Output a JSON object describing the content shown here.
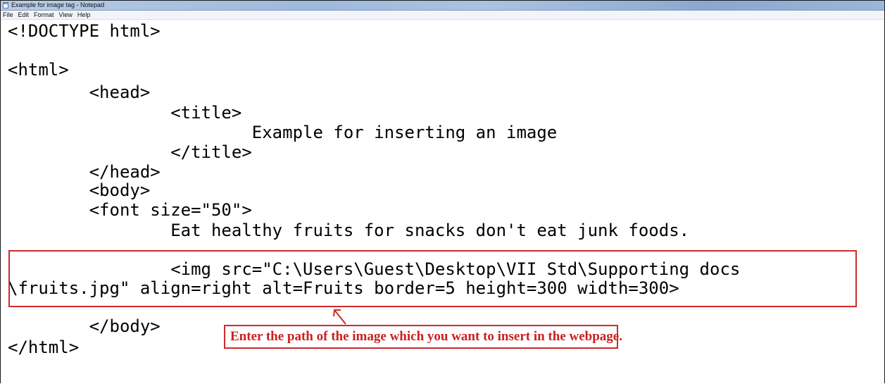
{
  "window": {
    "title": "Example for image tag - Notepad"
  },
  "menu": {
    "items": [
      "File",
      "Edit",
      "Format",
      "View",
      "Help"
    ]
  },
  "editor": {
    "lines": [
      "<!DOCTYPE html>",
      "<html>",
      "        <head>",
      "                <title>",
      "                        Example for inserting an image",
      "                </title>",
      "        </head>",
      "        <body>",
      "        <font size=\"50\">",
      "                Eat healthy fruits for snacks don't eat junk foods.",
      "                <img src=\"C:\\Users\\Guest\\Desktop\\VII Std\\Supporting docs",
      "\\fruits.jpg\" align=right alt=Fruits border=5 height=300 width=300>",
      "        </body>",
      "</html>"
    ]
  },
  "annotation": {
    "callout_text": "Enter the path of the image which you want to insert in the webpage.",
    "color": "#cc2b2b"
  }
}
